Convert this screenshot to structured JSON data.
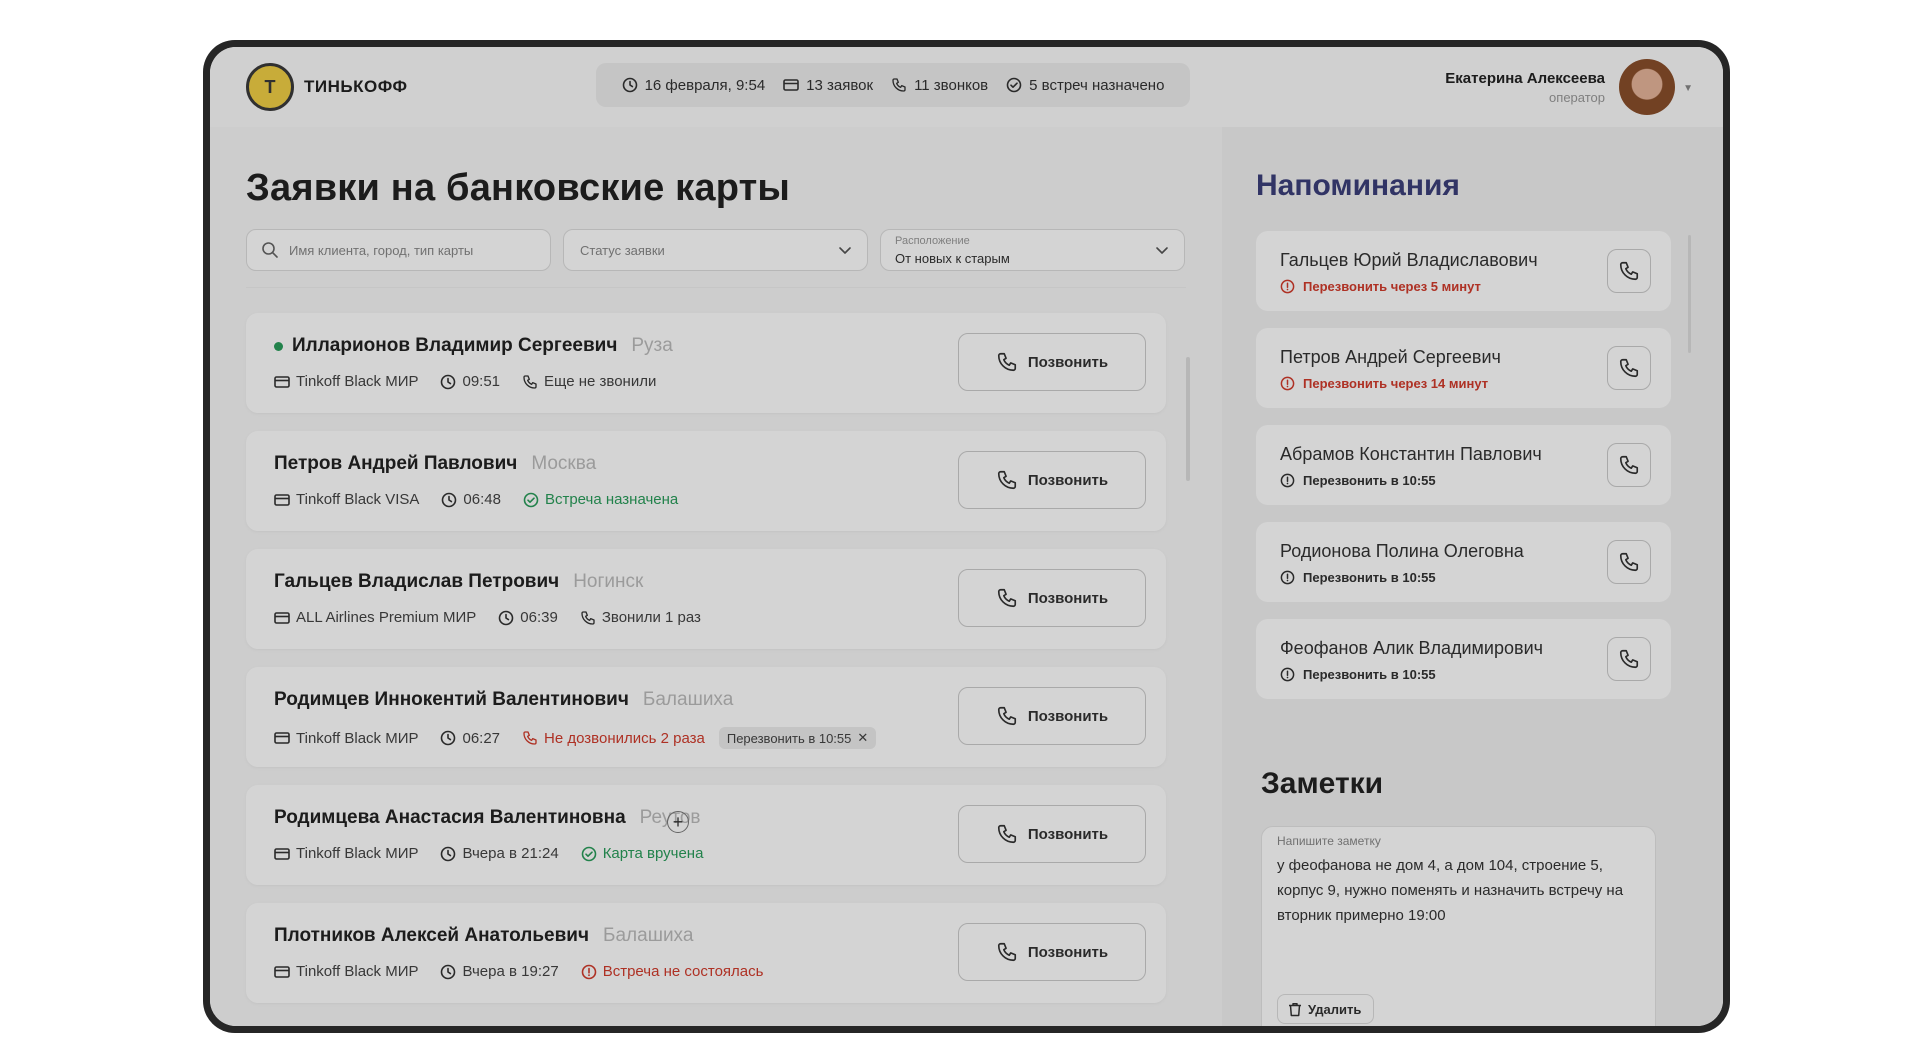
{
  "header": {
    "logo_text": "ТИНЬКОФФ",
    "stats": {
      "datetime": "16 февраля, 9:54",
      "requests": "13 заявок",
      "calls": "11 звонков",
      "meetings": "5 встреч назначено"
    },
    "user": {
      "name": "Екатерина Алексеева",
      "role": "оператор"
    }
  },
  "main": {
    "title": "Заявки на банковские карты",
    "filters": {
      "search_placeholder": "Имя клиента, город, тип карты",
      "status_placeholder": "Статус заявки",
      "sort_label": "Расположение",
      "sort_value": "От новых к старым"
    },
    "call_label": "Позвонить",
    "cards": [
      {
        "name": "Илларионов Владимир Сергеевич",
        "city": "Руза",
        "card": "Tinkoff Black МИР",
        "time": "09:51",
        "status": "Еще не звонили",
        "status_kind": "call"
      },
      {
        "name": "Петров Андрей Павлович",
        "city": "Москва",
        "card": "Tinkoff Black VISA",
        "time": "06:48",
        "status": "Встреча назначена",
        "status_kind": "ok"
      },
      {
        "name": "Гальцев Владислав Петрович",
        "city": "Ногинск",
        "card": "ALL Airlines Premium МИР",
        "time": "06:39",
        "status": "Звонили 1 раз",
        "status_kind": "call"
      },
      {
        "name": "Родимцев Иннокентий Валентинович",
        "city": "Балашиха",
        "card": "Tinkoff Black МИР",
        "time": "06:27",
        "status": "Не дозвонились 2 раза",
        "status_kind": "missed",
        "tag": "Перезвонить в 10:55"
      },
      {
        "name": "Родимцева Анастасия Валентиновна",
        "city": "Реутов",
        "card": "Tinkoff Black МИР",
        "time": "Вчера в 21:24",
        "status": "Карта вручена",
        "status_kind": "ok"
      },
      {
        "name": "Плотников Алексей Анатольевич",
        "city": "Балашиха",
        "card": "Tinkoff Black МИР",
        "time": "Вчера в 19:27",
        "status": "Встреча не состоялась",
        "status_kind": "fail"
      }
    ]
  },
  "sidebar": {
    "reminders_title": "Напоминания",
    "reminders": [
      {
        "name": "Гальцев Юрий Владиславович",
        "note": "Перезвонить через 5 минут",
        "urgent": true
      },
      {
        "name": "Петров Андрей Сергеевич",
        "note": "Перезвонить через 14 минут",
        "urgent": true
      },
      {
        "name": "Абрамов Константин Павлович",
        "note": "Перезвонить в 10:55",
        "urgent": false
      },
      {
        "name": "Родионова Полина Олеговна",
        "note": "Перезвонить в 10:55",
        "urgent": false
      },
      {
        "name": "Феофанов Алик Владимирович",
        "note": "Перезвонить в 10:55",
        "urgent": false
      }
    ],
    "notes_title": "Заметки",
    "note": {
      "label": "Напишите заметку",
      "text": "у феофанова не дом 4, а дом 104, строение 5, корпус 9, нужно поменять и назначить встречу на вторник примерно 19:00",
      "delete_label": "Удалить"
    }
  },
  "colors": {
    "green": "#2a9d5b",
    "red": "#d23b2c",
    "accent_title": "#3b3f7a",
    "logo_yellow": "#f1cf45"
  },
  "icons": [
    "clock-icon",
    "card-icon",
    "phone-icon",
    "check-circle-icon",
    "alert-circle-icon",
    "search-icon",
    "chevron-down-icon",
    "trash-icon",
    "plus-icon"
  ]
}
